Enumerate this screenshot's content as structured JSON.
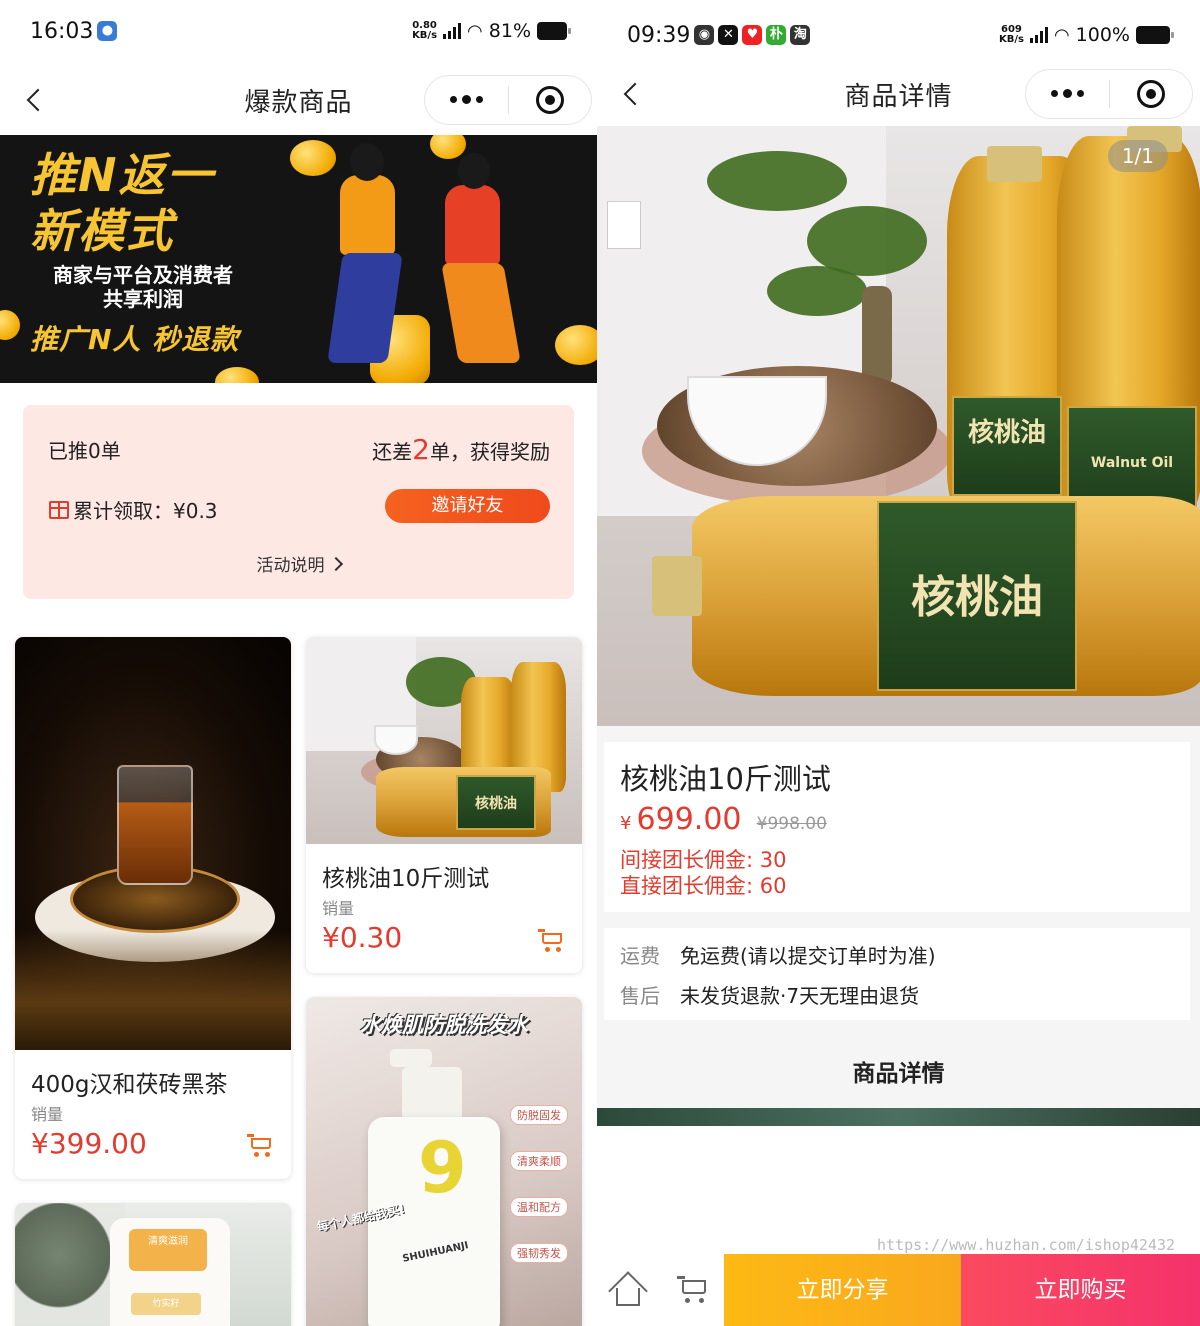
{
  "left": {
    "status": {
      "time": "16:03",
      "speed_top": "0.80",
      "speed_bottom": "KB/s",
      "net": "5G",
      "battery": "81%"
    },
    "nav": {
      "title": "爆款商品"
    },
    "banner": {
      "headline1": "推N返一",
      "headline2": "新模式",
      "line1": "商家与平台及消费者",
      "line2": "共享利润",
      "line3": "推广N人 秒退款"
    },
    "promo": {
      "pushed": "已推0单",
      "need_prefix": "还差",
      "need_num": "2",
      "need_suffix": "单，获得奖励",
      "total": "累计领取：¥0.3",
      "invite": "邀请好友",
      "rules": "活动说明"
    },
    "products": [
      {
        "name": "400g汉和茯砖黑茶",
        "sales": "销量",
        "price": "¥399.00"
      },
      {
        "name": "核桃油10斤测试",
        "sales": "销量",
        "price": "¥0.30"
      }
    ],
    "shampoo": {
      "title": "水焕肌防脱洗发水",
      "brand": "SHUIHUANJI",
      "quote": "每个人都给我买!",
      "tags": [
        "防脱固发",
        "清爽柔顺",
        "温和配方",
        "强韧秀发"
      ]
    },
    "card4": {
      "label": "清爽滋润",
      "label2": "竹实籽"
    }
  },
  "right": {
    "status": {
      "time": "09:39",
      "speed_top": "609",
      "speed_bottom": "KB/s",
      "net": "5G",
      "battery": "100%"
    },
    "nav": {
      "title": "商品详情"
    },
    "gallery": {
      "counter": "1/1",
      "label_cn": "核桃油",
      "label_en": "Walnut Oil"
    },
    "product": {
      "title": "核桃油10斤测试",
      "currency": "¥",
      "price": "699.00",
      "old_price": "¥998.00",
      "comm1": "间接团长佣金: 30",
      "comm2": "直接团长佣金: 60"
    },
    "shipping": {
      "fee_label": "运费",
      "fee_value": "免运费(请以提交订单时为准)",
      "after_label": "售后",
      "after_value": "未发货退款·7天无理由退货"
    },
    "detail_header": "商品详情",
    "watermark": "https://www.huzhan.com/ishop42432",
    "bottom": {
      "share": "立即分享",
      "buy": "立即购买"
    }
  },
  "colors": {
    "accent_red": "#e53a2e",
    "orange": "#f26a1b",
    "share": "#fdb913",
    "buy": "#f4326b"
  }
}
